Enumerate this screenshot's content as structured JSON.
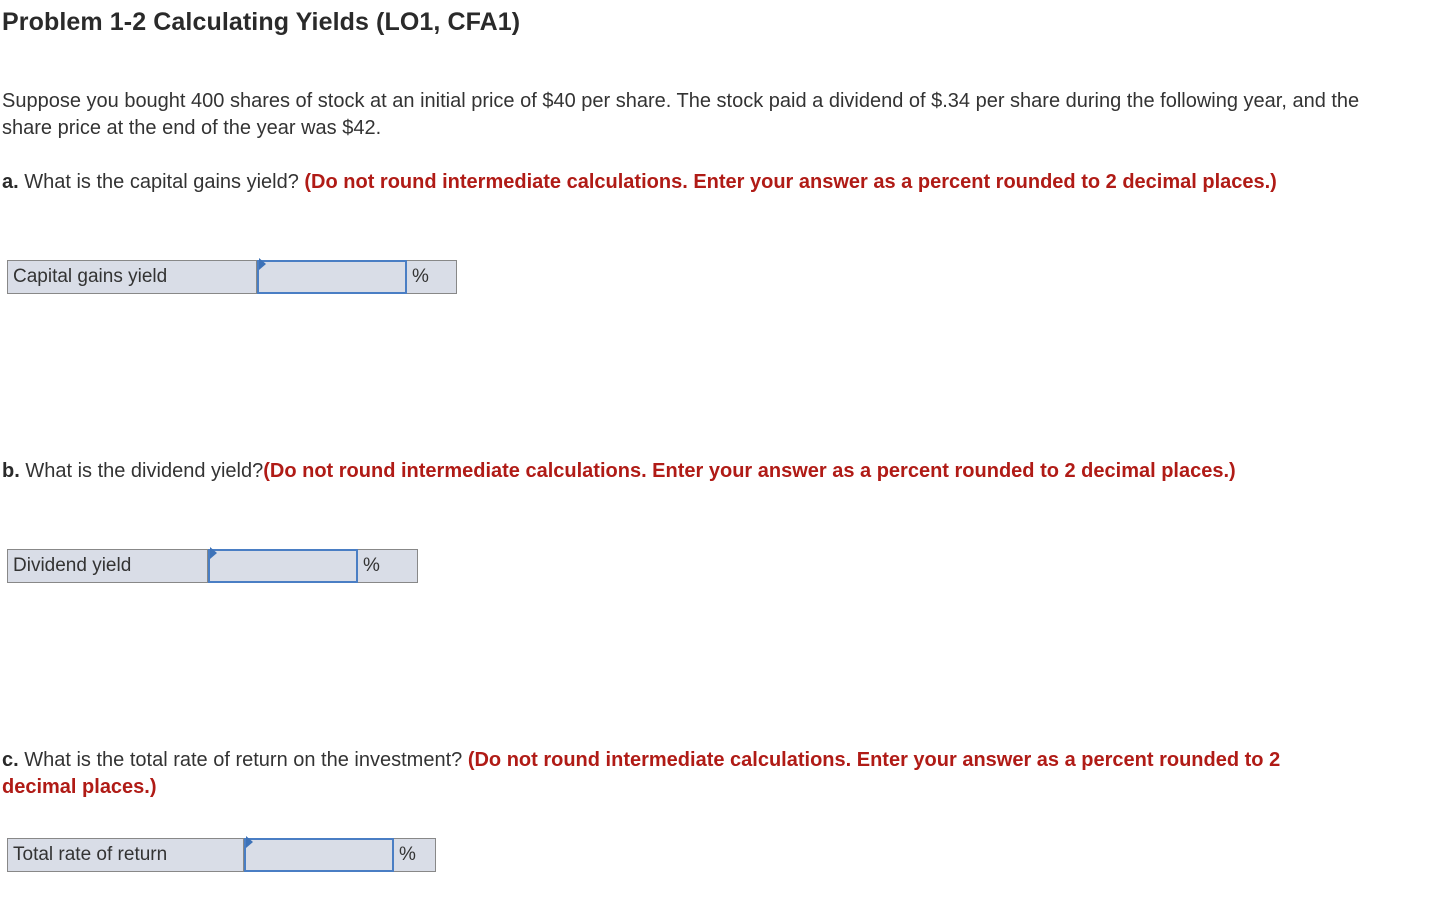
{
  "title": "Problem 1-2 Calculating Yields (LO1, CFA1)",
  "intro": "Suppose you bought 400 shares of stock at an initial price of $40 per share. The stock paid a dividend of $.34 per share during the following year, and the share price at the end of the year was $42.",
  "questions": [
    {
      "letter": "a.",
      "text": " What is the capital gains yield? ",
      "instruction": "(Do not round intermediate calculations. Enter your answer as a percent rounded to 2 decimal places.)",
      "field_label": "Capital gains yield",
      "value": "",
      "unit": "%"
    },
    {
      "letter": "b.",
      "text": " What is the dividend yield?",
      "instruction": "(Do not round intermediate calculations. Enter your answer as a percent rounded to 2 decimal places.)",
      "field_label": "Dividend yield",
      "value": "",
      "unit": "%"
    },
    {
      "letter": "c.",
      "text": " What is the total rate of return on the investment? ",
      "instruction": "(Do not round intermediate calculations. Enter your answer as a percent rounded to 2 decimal places.)",
      "field_label": "Total rate of return",
      "value": "",
      "unit": "%"
    }
  ]
}
